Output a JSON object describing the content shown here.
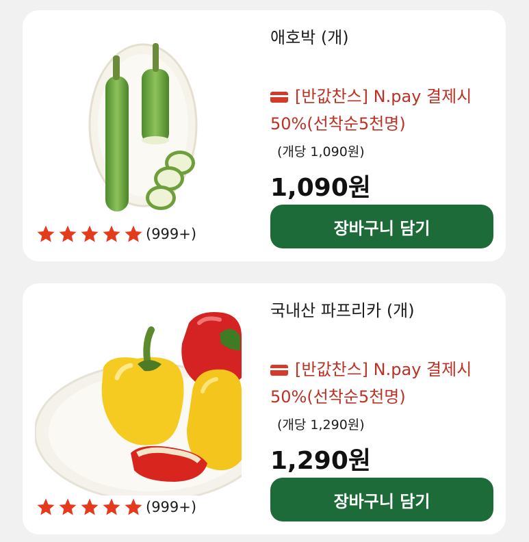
{
  "products": [
    {
      "name": "애호박 (개)",
      "promo": "[반값찬스] N.pay 결제시 50%(선착순5천명)",
      "unit_price": "(개당 1,090원)",
      "price": "1,090원",
      "cart_button": "장바구니 담기",
      "rating_count": "(999+)",
      "rating_stars": 5,
      "image_icon": "zucchini-image"
    },
    {
      "name": "국내산 파프리카 (개)",
      "promo": "[반값찬스] N.pay 결제시 50%(선착순5천명)",
      "unit_price": "(개당 1,290원)",
      "price": "1,290원",
      "cart_button": "장바구니 담기",
      "rating_count": "(999+)",
      "rating_stars": 5,
      "image_icon": "paprika-image"
    }
  ],
  "colors": {
    "promo_text": "#bd3124",
    "cart_button": "#1e6b3a",
    "star": "#e63a1e"
  }
}
